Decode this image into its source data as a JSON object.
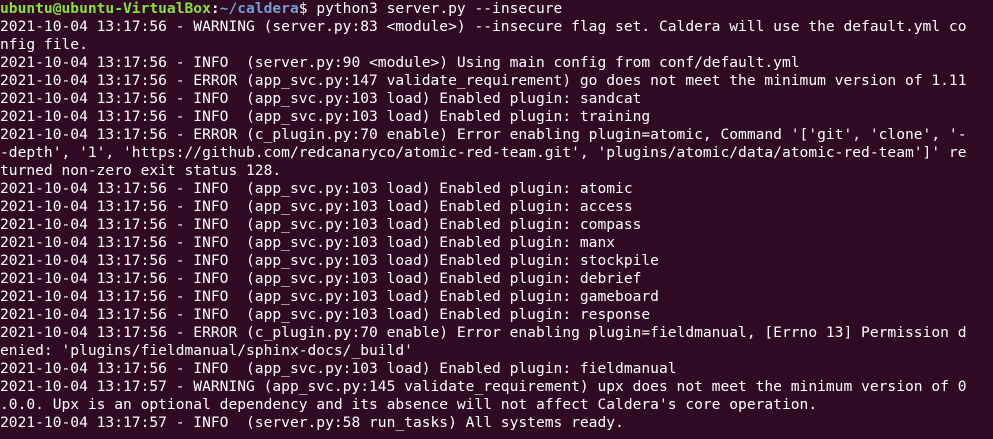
{
  "prompt": {
    "user_host": "ubuntu@ubuntu-VirtualBox",
    "colon": ":",
    "path": "~/caldera",
    "dollar": "$ ",
    "command": "python3 server.py --insecure"
  },
  "lines": [
    "2021-10-04 13:17:56 - WARNING (server.py:83 <module>) --insecure flag set. Caldera will use the default.yml co",
    "nfig file.",
    "2021-10-04 13:17:56 - INFO  (server.py:90 <module>) Using main config from conf/default.yml",
    "2021-10-04 13:17:56 - ERROR (app_svc.py:147 validate_requirement) go does not meet the minimum version of 1.11",
    "2021-10-04 13:17:56 - INFO  (app_svc.py:103 load) Enabled plugin: sandcat",
    "2021-10-04 13:17:56 - INFO  (app_svc.py:103 load) Enabled plugin: training",
    "2021-10-04 13:17:56 - ERROR (c_plugin.py:70 enable) Error enabling plugin=atomic, Command '['git', 'clone', '-",
    "-depth', '1', 'https://github.com/redcanaryco/atomic-red-team.git', 'plugins/atomic/data/atomic-red-team']' re",
    "turned non-zero exit status 128.",
    "2021-10-04 13:17:56 - INFO  (app_svc.py:103 load) Enabled plugin: atomic",
    "2021-10-04 13:17:56 - INFO  (app_svc.py:103 load) Enabled plugin: access",
    "2021-10-04 13:17:56 - INFO  (app_svc.py:103 load) Enabled plugin: compass",
    "2021-10-04 13:17:56 - INFO  (app_svc.py:103 load) Enabled plugin: manx",
    "2021-10-04 13:17:56 - INFO  (app_svc.py:103 load) Enabled plugin: stockpile",
    "2021-10-04 13:17:56 - INFO  (app_svc.py:103 load) Enabled plugin: debrief",
    "2021-10-04 13:17:56 - INFO  (app_svc.py:103 load) Enabled plugin: gameboard",
    "2021-10-04 13:17:56 - INFO  (app_svc.py:103 load) Enabled plugin: response",
    "2021-10-04 13:17:56 - ERROR (c_plugin.py:70 enable) Error enabling plugin=fieldmanual, [Errno 13] Permission d",
    "enied: 'plugins/fieldmanual/sphinx-docs/_build'",
    "2021-10-04 13:17:56 - INFO  (app_svc.py:103 load) Enabled plugin: fieldmanual",
    "2021-10-04 13:17:57 - WARNING (app_svc.py:145 validate_requirement) upx does not meet the minimum version of 0",
    ".0.0. Upx is an optional dependency and its absence will not affect Caldera's core operation.",
    "2021-10-04 13:17:57 - INFO  (server.py:58 run_tasks) All systems ready."
  ],
  "colors": {
    "background": "#300a24",
    "text": "#ffffff",
    "prompt_user": "#8ae234",
    "prompt_path": "#729fcf"
  }
}
